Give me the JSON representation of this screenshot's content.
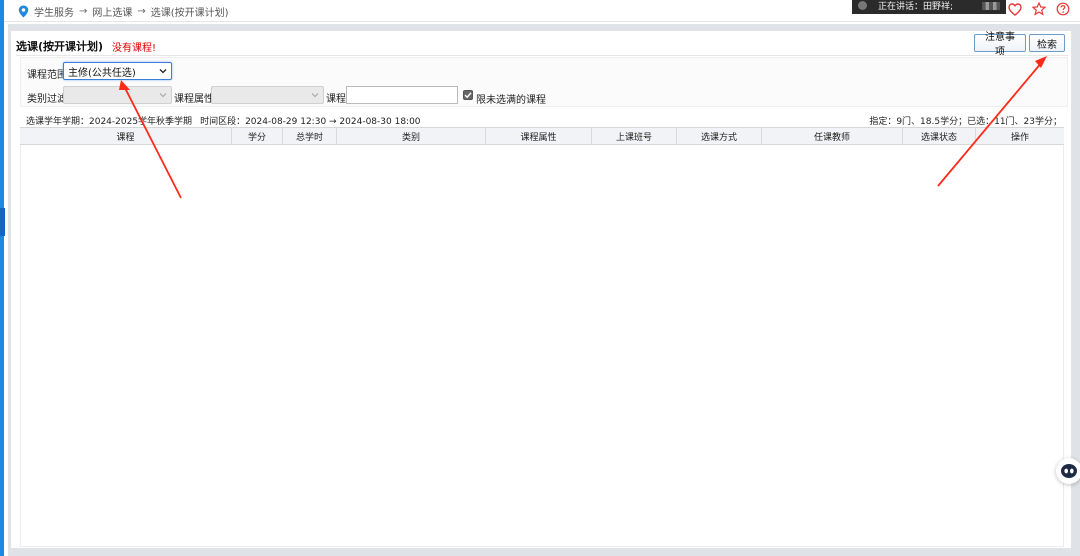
{
  "breadcrumb": {
    "items": [
      "学生服务",
      "网上选课",
      "选课(按开课计划)"
    ],
    "separator": "→"
  },
  "overlay": {
    "speaking_text": "正在讲话：田野祥;"
  },
  "panel": {
    "title": "选课(按开课计划)",
    "no_course_msg": "没有课程!",
    "notice_button": "注意事项",
    "search_button": "检索"
  },
  "filters": {
    "scope_label": "课程范围",
    "scope_value": "主修(公共任选)",
    "category_label": "类别过滤",
    "attribute_label": "课程属性",
    "course_label": "课程",
    "course_value": "",
    "limit_label": "限未选满的课程",
    "limit_checked": true
  },
  "info": {
    "semester": "选课学年学期：2024-2025学年秋季学期",
    "time_range": "时间区段：2024-08-29 12:30 → 2024-08-30 18:00",
    "summary": "指定：9门、18.5学分；已选：11门、23学分；"
  },
  "table": {
    "columns": [
      "课程",
      "学分",
      "总学时",
      "类别",
      "课程属性",
      "上课班号",
      "选课方式",
      "任课教师",
      "选课状态",
      "操作"
    ],
    "rows": []
  },
  "colors": {
    "accent": "#1e88e5",
    "error": "#e00000",
    "annotation_arrow": "#ff2a1a",
    "icon_red": "#e53935"
  }
}
